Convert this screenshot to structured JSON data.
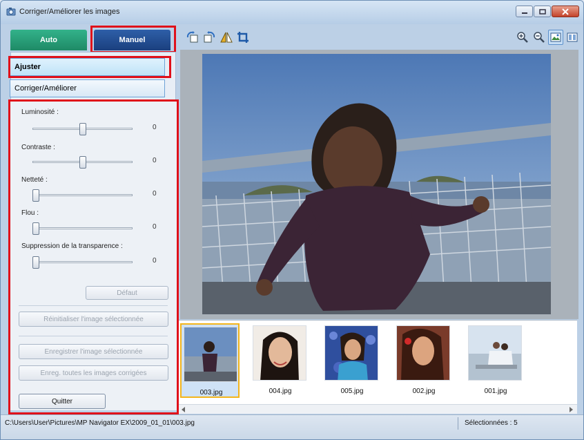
{
  "window": {
    "title": "Corriger/Améliorer les images"
  },
  "tabs": {
    "auto": "Auto",
    "manuel": "Manuel"
  },
  "mode_list": {
    "ajuster": "Ajuster",
    "corriger": "Corriger/Améliorer"
  },
  "sliders": [
    {
      "label": "Luminosité :",
      "value": "0",
      "level": 0.5
    },
    {
      "label": "Contraste :",
      "value": "0",
      "level": 0.5
    },
    {
      "label": "Netteté :",
      "value": "0",
      "level": 0.0
    },
    {
      "label": "Flou :",
      "value": "0",
      "level": 0.0
    },
    {
      "label": "Suppression de la transparence :",
      "value": "0",
      "level": 0.0
    }
  ],
  "buttons": {
    "default": "Défaut",
    "reset": "Réinitialiser l'image sélectionnée",
    "save_selected": "Enregistrer l'image sélectionnée",
    "save_all": "Enreg. toutes les images corrigées",
    "quit": "Quitter"
  },
  "thumbnails": [
    {
      "name": "003.jpg",
      "selected": true
    },
    {
      "name": "004.jpg",
      "selected": false
    },
    {
      "name": "005.jpg",
      "selected": false
    },
    {
      "name": "002.jpg",
      "selected": false
    },
    {
      "name": "001.jpg",
      "selected": false
    }
  ],
  "status": {
    "path": "C:\\Users\\User\\Pictures\\MP Navigator EX\\2009_01_01\\003.jpg",
    "selected_count": "Sélectionnées : 5"
  },
  "colors": {
    "highlight": "#e0101a",
    "tab_auto": "#1e8a66",
    "tab_manuel": "#1a3f7e"
  }
}
